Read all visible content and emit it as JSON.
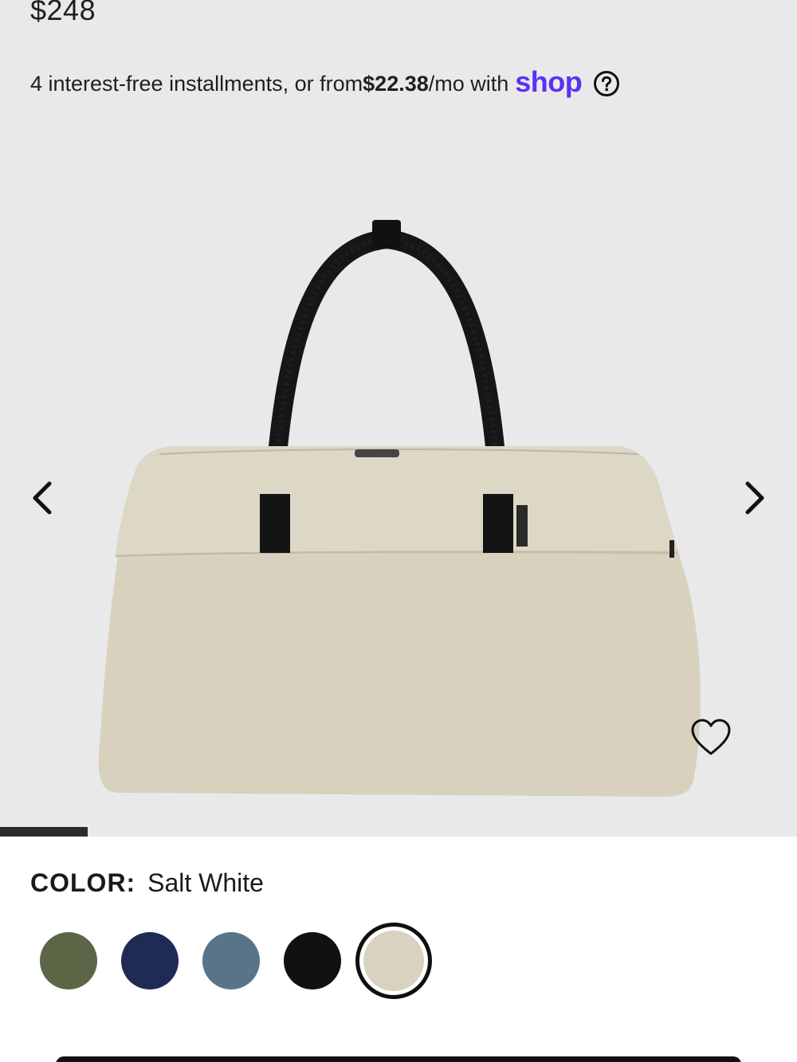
{
  "price": "$248",
  "installments": {
    "prefix": "4 interest-free installments, or from ",
    "amount": "$22.38",
    "suffix": "/mo with",
    "provider": "shop"
  },
  "icons": {
    "help": "question-circle-icon",
    "prev": "chevron-left-icon",
    "next": "chevron-right-icon",
    "wishlist": "heart-icon"
  },
  "gallery": {
    "progress_fraction": 0.11
  },
  "color": {
    "label": "COLOR:",
    "selected": "Salt White",
    "swatches": [
      {
        "hex": "#5b6647"
      },
      {
        "hex": "#1f2a55"
      },
      {
        "hex": "#577489"
      },
      {
        "hex": "#111111"
      },
      {
        "hex": "#d9d2c0",
        "selected": true
      }
    ]
  }
}
